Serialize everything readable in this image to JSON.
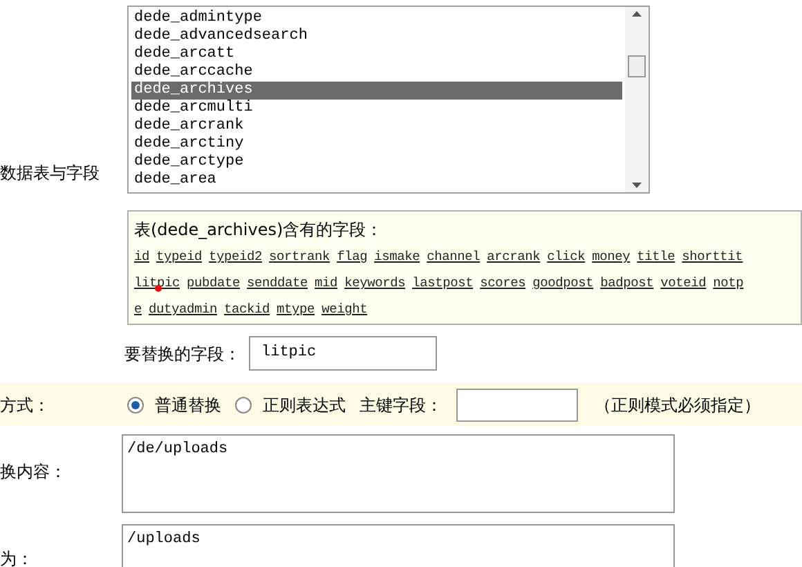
{
  "table_select": {
    "label": "数据表与字段",
    "options": [
      {
        "text": "dede_admintype",
        "selected": false
      },
      {
        "text": "dede_advancedsearch",
        "selected": false
      },
      {
        "text": "dede_arcatt",
        "selected": false
      },
      {
        "text": "dede_arccache",
        "selected": false
      },
      {
        "text": "dede_archives",
        "selected": true
      },
      {
        "text": "dede_arcmulti",
        "selected": false
      },
      {
        "text": "dede_arcrank",
        "selected": false
      },
      {
        "text": "dede_arctiny",
        "selected": false
      },
      {
        "text": "dede_arctype",
        "selected": false
      },
      {
        "text": "dede_area",
        "selected": false
      }
    ]
  },
  "fields_panel": {
    "heading": "表(dede_archives)含有的字段：",
    "lines": [
      [
        "id",
        "typeid",
        "typeid2",
        "sortrank",
        "flag",
        "ismake",
        "channel",
        "arcrank",
        "click",
        "money",
        "title",
        "shorttit"
      ],
      [
        "litpic",
        "pubdate",
        "senddate",
        "mid",
        "keywords",
        "lastpost",
        "scores",
        "goodpost",
        "badpost",
        "voteid",
        "notp"
      ],
      [
        "e",
        "dutyadmin",
        "tackid",
        "mtype",
        "weight"
      ]
    ]
  },
  "target_field": {
    "label": "要替换的字段：",
    "value": "litpic"
  },
  "mode": {
    "label": "方式：",
    "options": [
      {
        "text": "普通替换",
        "selected": true
      },
      {
        "text": "正则表达式",
        "selected": false
      }
    ],
    "key_label": "主键字段：",
    "hint": "（正则模式必须指定）"
  },
  "find": {
    "label": "换内容：",
    "value": "/de/uploads"
  },
  "replace": {
    "label": "为：",
    "value": "/uploads"
  }
}
